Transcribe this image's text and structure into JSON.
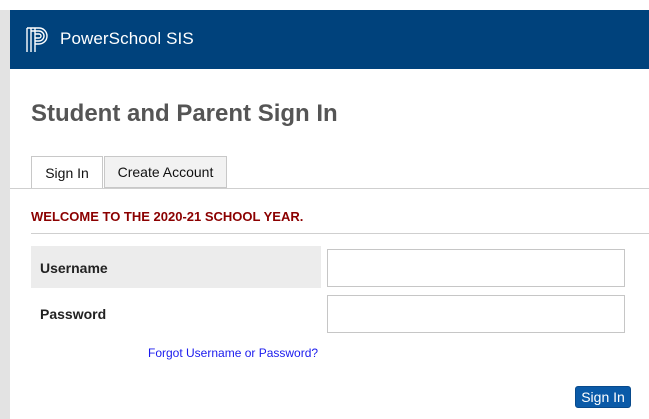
{
  "app": {
    "name": "PowerSchool SIS",
    "logo_icon": "powerschool-p-logo-icon",
    "header_color": "#00427c"
  },
  "page": {
    "title": "Student and Parent Sign In"
  },
  "tabs": [
    {
      "label": "Sign In",
      "active": true
    },
    {
      "label": "Create Account",
      "active": false
    }
  ],
  "welcome": {
    "message": "WELCOME TO THE 2020-21 SCHOOL YEAR.",
    "color": "#8b0000"
  },
  "form": {
    "username_label": "Username",
    "username_value": "",
    "password_label": "Password",
    "password_value": "",
    "forgot_link": "Forgot Username or Password?",
    "submit_label": "Sign In"
  }
}
